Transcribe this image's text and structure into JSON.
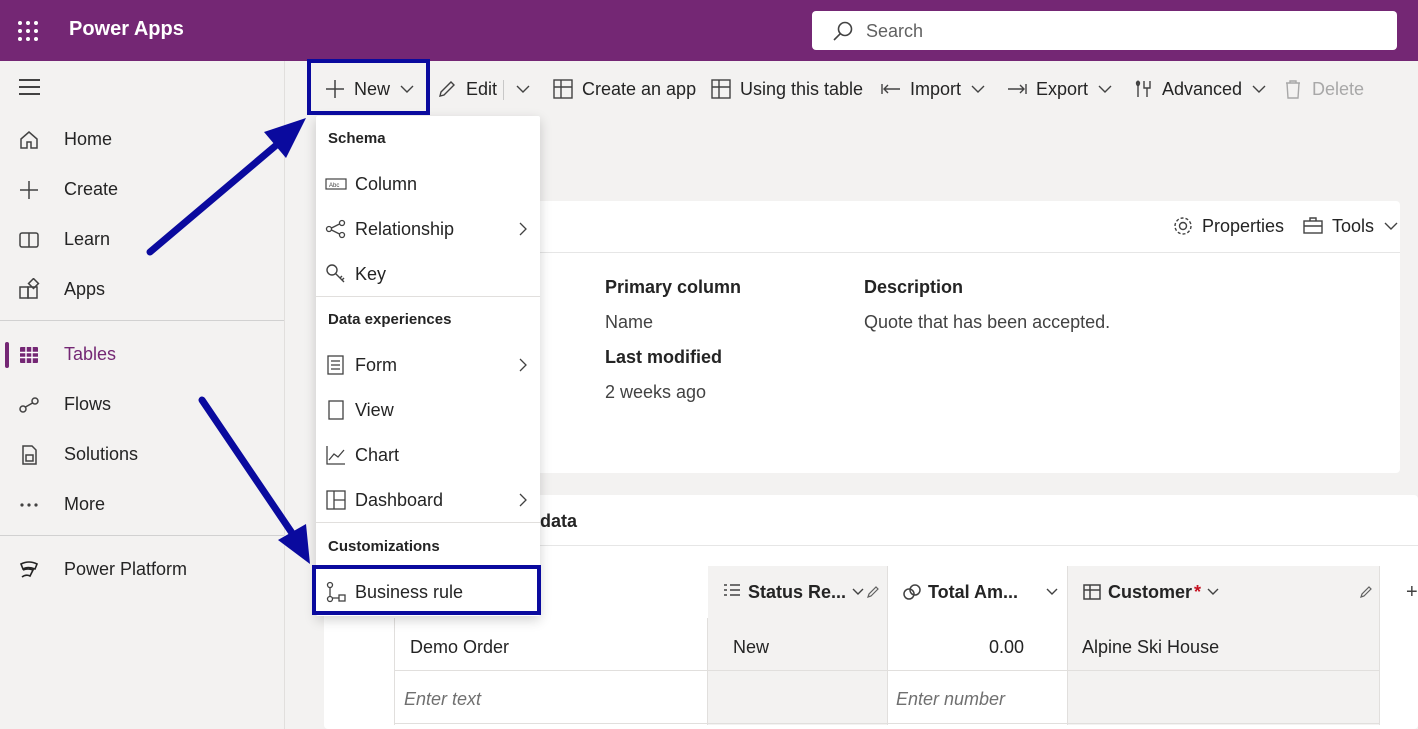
{
  "app": {
    "title": "Power Apps"
  },
  "search": {
    "placeholder": "Search"
  },
  "nav": {
    "items": [
      {
        "label": "Home",
        "icon": "home-icon"
      },
      {
        "label": "Create",
        "icon": "plus-icon"
      },
      {
        "label": "Learn",
        "icon": "book-icon"
      },
      {
        "label": "Apps",
        "icon": "apps-icon"
      },
      {
        "label": "Tables",
        "icon": "table-grid-icon",
        "active": true
      },
      {
        "label": "Flows",
        "icon": "flow-icon"
      },
      {
        "label": "Solutions",
        "icon": "solutions-icon"
      },
      {
        "label": "More",
        "icon": "more-icon"
      },
      {
        "label": "Power Platform",
        "icon": "power-platform-icon"
      }
    ]
  },
  "toolbar": {
    "new_label": "New",
    "edit_label": "Edit",
    "create_app_label": "Create an app",
    "using_table_label": "Using this table",
    "import_label": "Import",
    "export_label": "Export",
    "advanced_label": "Advanced",
    "delete_label": "Delete"
  },
  "card": {
    "properties_label": "Properties",
    "tools_label": "Tools",
    "primary_column_label": "Primary column",
    "primary_column_value": "Name",
    "last_modified_label": "Last modified",
    "last_modified_value": "2 weeks ago",
    "description_label": "Description",
    "description_value": "Quote that has been accepted."
  },
  "data_card": {
    "title_fragment": "data",
    "columns": [
      {
        "label": "Status Re...",
        "icon": "choice-list-icon"
      },
      {
        "label": "Total Am...",
        "icon": "currency-icon"
      },
      {
        "label": "Customer",
        "icon": "lookup-icon",
        "required_mark": "*"
      }
    ],
    "row": {
      "name": "Demo Order",
      "status": "New",
      "total": "0.00",
      "customer": "Alpine Ski House"
    },
    "placeholders": {
      "text": "Enter text",
      "number": "Enter number"
    },
    "add_column": "+"
  },
  "menu": {
    "sections": [
      {
        "title": "Schema",
        "items": [
          {
            "label": "Column",
            "icon": "column-icon"
          },
          {
            "label": "Relationship",
            "icon": "relationship-icon",
            "submenu": true
          },
          {
            "label": "Key",
            "icon": "key-icon"
          }
        ]
      },
      {
        "title": "Data experiences",
        "items": [
          {
            "label": "Form",
            "icon": "form-icon",
            "submenu": true
          },
          {
            "label": "View",
            "icon": "view-icon"
          },
          {
            "label": "Chart",
            "icon": "chart-icon"
          },
          {
            "label": "Dashboard",
            "icon": "dashboard-icon",
            "submenu": true
          }
        ]
      },
      {
        "title": "Customizations",
        "items": [
          {
            "label": "Business rule",
            "icon": "business-rule-icon"
          }
        ]
      }
    ]
  },
  "colors": {
    "brand": "#742774",
    "annotation": "#0a0a9e"
  }
}
